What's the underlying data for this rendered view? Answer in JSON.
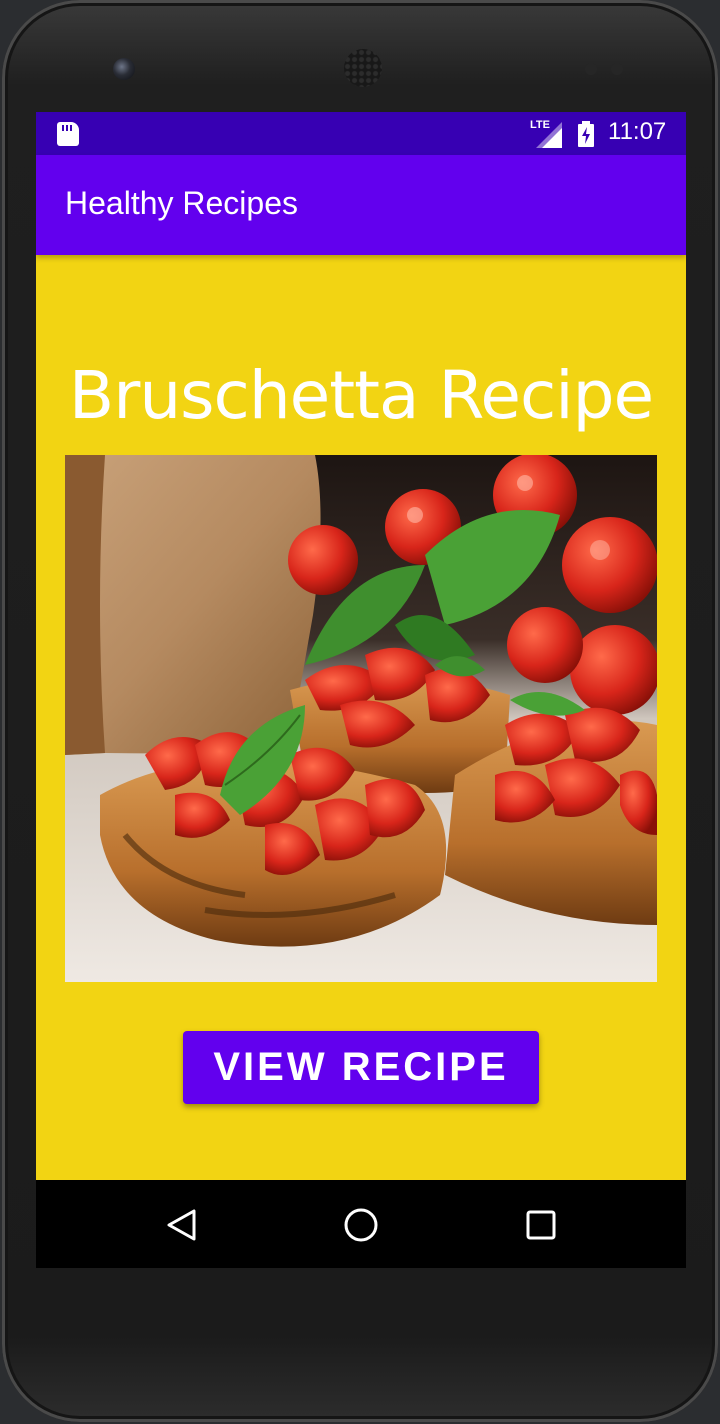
{
  "status_bar": {
    "network_label": "LTE",
    "time": "11:07",
    "icons": [
      "sd-card-icon",
      "signal-icon",
      "battery-charging-icon"
    ]
  },
  "app_bar": {
    "title": "Healthy Recipes"
  },
  "main": {
    "recipe_title": "Bruschetta Recipe",
    "image_subject": "bruschetta with tomatoes and basil on grilled bread",
    "view_button_label": "VIEW RECIPE"
  },
  "nav_bar": {
    "icons": [
      "back-icon",
      "home-icon",
      "recents-icon"
    ]
  },
  "colors": {
    "screen_background": "#f2d413",
    "primary": "#6200ee",
    "primary_dark": "#3700b3",
    "nav_bar": "#000000"
  }
}
